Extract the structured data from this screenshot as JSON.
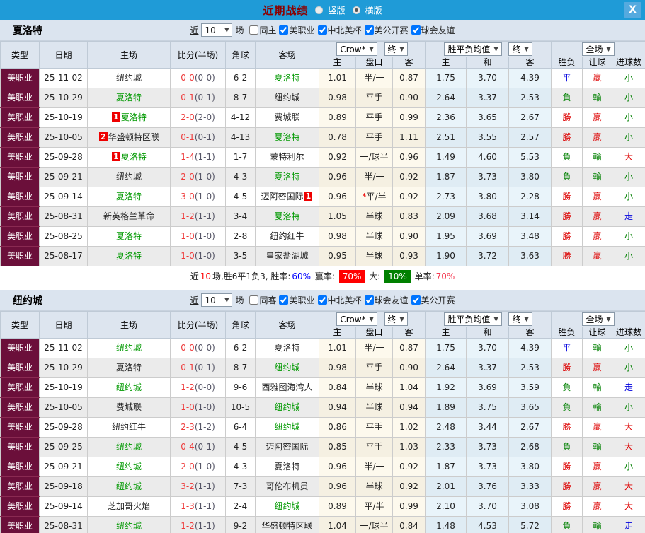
{
  "titlebar": {
    "title": "近期战绩",
    "vertical_label": "竖版",
    "horizontal_label": "横版",
    "horizontal_selected": true
  },
  "icons": {
    "dropdown_arrow": "▼",
    "close": "X"
  },
  "columns": {
    "type": "类型",
    "date": "日期",
    "home": "主场",
    "score": "比分(半场)",
    "corner": "角球",
    "away": "客场",
    "crow": "Crow*",
    "final": "终",
    "avg": "胜平负均值",
    "full": "全场",
    "sub": [
      "主",
      "盘口",
      "客",
      "主",
      "和",
      "客",
      "胜负",
      "让球",
      "进球数"
    ]
  },
  "sections": [
    {
      "team": "夏洛特",
      "near_label": "近",
      "count": "10",
      "games_label": "场",
      "same_label": "同主",
      "same_checked": false,
      "leagues": [
        {
          "label": "美职业",
          "checked": true
        },
        {
          "label": "中北美杯",
          "checked": true
        },
        {
          "label": "美公开赛",
          "checked": true
        },
        {
          "label": "球会友谊",
          "checked": true
        }
      ],
      "rows": [
        {
          "league": "美职业",
          "date": "25-11-02",
          "home": {
            "name": "纽约城",
            "self": false
          },
          "score_ft": "0-0",
          "score_ht": "(0-0)",
          "corner": "6-2",
          "away": {
            "name": "夏洛特",
            "self": true
          },
          "odds_home": "1.01",
          "handicap": "半/一",
          "handicap_star": false,
          "odds_away": "0.87",
          "avg_home": "1.75",
          "avg_draw": "3.70",
          "avg_away": "4.39",
          "res_wdl": {
            "t": "平",
            "c": "blue"
          },
          "res_handicap": {
            "t": "贏",
            "c": "red"
          },
          "res_goals": {
            "t": "小",
            "c": "green"
          }
        },
        {
          "league": "美职业",
          "date": "25-10-29",
          "home": {
            "name": "夏洛特",
            "self": true
          },
          "score_ft": "0-1",
          "score_ht": "(0-1)",
          "corner": "8-7",
          "away": {
            "name": "纽约城",
            "self": false
          },
          "odds_home": "0.98",
          "handicap": "平手",
          "handicap_star": false,
          "odds_away": "0.90",
          "avg_home": "2.64",
          "avg_draw": "3.37",
          "avg_away": "2.53",
          "res_wdl": {
            "t": "負",
            "c": "green"
          },
          "res_handicap": {
            "t": "輸",
            "c": "green"
          },
          "res_goals": {
            "t": "小",
            "c": "green"
          }
        },
        {
          "league": "美职业",
          "date": "25-10-19",
          "home": {
            "name": "夏洛特",
            "self": true,
            "badge": "1",
            "badge_pos": "before"
          },
          "score_ft": "2-0",
          "score_ht": "(2-0)",
          "corner": "4-12",
          "away": {
            "name": "费城联",
            "self": false
          },
          "odds_home": "0.89",
          "handicap": "平手",
          "handicap_star": false,
          "odds_away": "0.99",
          "avg_home": "2.36",
          "avg_draw": "3.65",
          "avg_away": "2.67",
          "res_wdl": {
            "t": "勝",
            "c": "red"
          },
          "res_handicap": {
            "t": "贏",
            "c": "red"
          },
          "res_goals": {
            "t": "小",
            "c": "green"
          }
        },
        {
          "league": "美职业",
          "date": "25-10-05",
          "home": {
            "name": "华盛顿特区联",
            "self": false,
            "badge": "2",
            "badge_pos": "before"
          },
          "score_ft": "0-1",
          "score_ht": "(0-1)",
          "corner": "4-13",
          "away": {
            "name": "夏洛特",
            "self": true
          },
          "odds_home": "0.78",
          "handicap": "平手",
          "handicap_star": false,
          "odds_away": "1.11",
          "avg_home": "2.51",
          "avg_draw": "3.55",
          "avg_away": "2.57",
          "res_wdl": {
            "t": "勝",
            "c": "red"
          },
          "res_handicap": {
            "t": "贏",
            "c": "red"
          },
          "res_goals": {
            "t": "小",
            "c": "green"
          }
        },
        {
          "league": "美职业",
          "date": "25-09-28",
          "home": {
            "name": "夏洛特",
            "self": true,
            "badge": "1",
            "badge_pos": "before"
          },
          "score_ft": "1-4",
          "score_ht": "(1-1)",
          "corner": "1-7",
          "away": {
            "name": "蒙特利尔",
            "self": false
          },
          "odds_home": "0.92",
          "handicap": "一/球半",
          "handicap_star": false,
          "odds_away": "0.96",
          "avg_home": "1.49",
          "avg_draw": "4.60",
          "avg_away": "5.53",
          "res_wdl": {
            "t": "負",
            "c": "green"
          },
          "res_handicap": {
            "t": "輸",
            "c": "green"
          },
          "res_goals": {
            "t": "大",
            "c": "red"
          }
        },
        {
          "league": "美职业",
          "date": "25-09-21",
          "home": {
            "name": "纽约城",
            "self": false
          },
          "score_ft": "2-0",
          "score_ht": "(1-0)",
          "corner": "4-3",
          "away": {
            "name": "夏洛特",
            "self": true
          },
          "odds_home": "0.96",
          "handicap": "半/一",
          "handicap_star": false,
          "odds_away": "0.92",
          "avg_home": "1.87",
          "avg_draw": "3.73",
          "avg_away": "3.80",
          "res_wdl": {
            "t": "負",
            "c": "green"
          },
          "res_handicap": {
            "t": "輸",
            "c": "green"
          },
          "res_goals": {
            "t": "小",
            "c": "green"
          }
        },
        {
          "league": "美职业",
          "date": "25-09-14",
          "home": {
            "name": "夏洛特",
            "self": true
          },
          "score_ft": "3-0",
          "score_ht": "(1-0)",
          "corner": "4-5",
          "away": {
            "name": "迈阿密国际",
            "self": false,
            "badge": "1",
            "badge_pos": "after"
          },
          "odds_home": "0.96",
          "handicap": "平/半",
          "handicap_star": true,
          "odds_away": "0.92",
          "avg_home": "2.73",
          "avg_draw": "3.80",
          "avg_away": "2.28",
          "res_wdl": {
            "t": "勝",
            "c": "red"
          },
          "res_handicap": {
            "t": "贏",
            "c": "red"
          },
          "res_goals": {
            "t": "小",
            "c": "green"
          }
        },
        {
          "league": "美职业",
          "date": "25-08-31",
          "home": {
            "name": "新英格兰革命",
            "self": false
          },
          "score_ft": "1-2",
          "score_ht": "(1-1)",
          "corner": "3-4",
          "away": {
            "name": "夏洛特",
            "self": true
          },
          "odds_home": "1.05",
          "handicap": "半球",
          "handicap_star": false,
          "odds_away": "0.83",
          "avg_home": "2.09",
          "avg_draw": "3.68",
          "avg_away": "3.14",
          "res_wdl": {
            "t": "勝",
            "c": "red"
          },
          "res_handicap": {
            "t": "贏",
            "c": "red"
          },
          "res_goals": {
            "t": "走",
            "c": "blue"
          }
        },
        {
          "league": "美职业",
          "date": "25-08-25",
          "home": {
            "name": "夏洛特",
            "self": true
          },
          "score_ft": "1-0",
          "score_ht": "(1-0)",
          "corner": "2-8",
          "away": {
            "name": "纽约红牛",
            "self": false
          },
          "odds_home": "0.98",
          "handicap": "半球",
          "handicap_star": false,
          "odds_away": "0.90",
          "avg_home": "1.95",
          "avg_draw": "3.69",
          "avg_away": "3.48",
          "res_wdl": {
            "t": "勝",
            "c": "red"
          },
          "res_handicap": {
            "t": "贏",
            "c": "red"
          },
          "res_goals": {
            "t": "小",
            "c": "green"
          }
        },
        {
          "league": "美职业",
          "date": "25-08-17",
          "home": {
            "name": "夏洛特",
            "self": true
          },
          "score_ft": "1-0",
          "score_ht": "(1-0)",
          "corner": "3-5",
          "away": {
            "name": "皇家盐湖城",
            "self": false
          },
          "odds_home": "0.95",
          "handicap": "半球",
          "handicap_star": false,
          "odds_away": "0.93",
          "avg_home": "1.90",
          "avg_draw": "3.72",
          "avg_away": "3.63",
          "res_wdl": {
            "t": "勝",
            "c": "red"
          },
          "res_handicap": {
            "t": "贏",
            "c": "red"
          },
          "res_goals": {
            "t": "小",
            "c": "green"
          }
        }
      ],
      "summary": [
        {
          "t": "近",
          "s": "plain"
        },
        {
          "t": "10",
          "s": "red"
        },
        {
          "t": "场,胜6平1负3, 胜率:",
          "s": "plain"
        },
        {
          "t": "60%",
          "s": "blue"
        },
        {
          "t": " 赢率: ",
          "s": "plain"
        },
        {
          "t": "70%",
          "s": "boxred"
        },
        {
          "t": " 大: ",
          "s": "plain"
        },
        {
          "t": "10%",
          "s": "boxgreen"
        },
        {
          "t": " 单率:",
          "s": "plain"
        },
        {
          "t": "70%",
          "s": "pink"
        }
      ]
    },
    {
      "team": "纽约城",
      "near_label": "近",
      "count": "10",
      "games_label": "场",
      "same_label": "同客",
      "same_checked": false,
      "leagues": [
        {
          "label": "美职业",
          "checked": true
        },
        {
          "label": "中北美杯",
          "checked": true
        },
        {
          "label": "球会友谊",
          "checked": true
        },
        {
          "label": "美公开赛",
          "checked": true
        }
      ],
      "rows": [
        {
          "league": "美职业",
          "date": "25-11-02",
          "home": {
            "name": "纽约城",
            "self": true
          },
          "score_ft": "0-0",
          "score_ht": "(0-0)",
          "corner": "6-2",
          "away": {
            "name": "夏洛特",
            "self": false
          },
          "odds_home": "1.01",
          "handicap": "半/一",
          "handicap_star": false,
          "odds_away": "0.87",
          "avg_home": "1.75",
          "avg_draw": "3.70",
          "avg_away": "4.39",
          "res_wdl": {
            "t": "平",
            "c": "blue"
          },
          "res_handicap": {
            "t": "輸",
            "c": "green"
          },
          "res_goals": {
            "t": "小",
            "c": "green"
          }
        },
        {
          "league": "美职业",
          "date": "25-10-29",
          "home": {
            "name": "夏洛特",
            "self": false
          },
          "score_ft": "0-1",
          "score_ht": "(0-1)",
          "corner": "8-7",
          "away": {
            "name": "纽约城",
            "self": true
          },
          "odds_home": "0.98",
          "handicap": "平手",
          "handicap_star": false,
          "odds_away": "0.90",
          "avg_home": "2.64",
          "avg_draw": "3.37",
          "avg_away": "2.53",
          "res_wdl": {
            "t": "勝",
            "c": "red"
          },
          "res_handicap": {
            "t": "贏",
            "c": "red"
          },
          "res_goals": {
            "t": "小",
            "c": "green"
          }
        },
        {
          "league": "美职业",
          "date": "25-10-19",
          "home": {
            "name": "纽约城",
            "self": true
          },
          "score_ft": "1-2",
          "score_ht": "(0-0)",
          "corner": "9-6",
          "away": {
            "name": "西雅图海湾人",
            "self": false
          },
          "odds_home": "0.84",
          "handicap": "半球",
          "handicap_star": false,
          "odds_away": "1.04",
          "avg_home": "1.92",
          "avg_draw": "3.69",
          "avg_away": "3.59",
          "res_wdl": {
            "t": "負",
            "c": "green"
          },
          "res_handicap": {
            "t": "輸",
            "c": "green"
          },
          "res_goals": {
            "t": "走",
            "c": "blue"
          }
        },
        {
          "league": "美职业",
          "date": "25-10-05",
          "home": {
            "name": "费城联",
            "self": false
          },
          "score_ft": "1-0",
          "score_ht": "(1-0)",
          "corner": "10-5",
          "away": {
            "name": "纽约城",
            "self": true
          },
          "odds_home": "0.94",
          "handicap": "半球",
          "handicap_star": false,
          "odds_away": "0.94",
          "avg_home": "1.89",
          "avg_draw": "3.75",
          "avg_away": "3.65",
          "res_wdl": {
            "t": "負",
            "c": "green"
          },
          "res_handicap": {
            "t": "輸",
            "c": "green"
          },
          "res_goals": {
            "t": "小",
            "c": "green"
          }
        },
        {
          "league": "美职业",
          "date": "25-09-28",
          "home": {
            "name": "纽约红牛",
            "self": false
          },
          "score_ft": "2-3",
          "score_ht": "(1-2)",
          "corner": "6-4",
          "away": {
            "name": "纽约城",
            "self": true
          },
          "odds_home": "0.86",
          "handicap": "平手",
          "handicap_star": false,
          "odds_away": "1.02",
          "avg_home": "2.48",
          "avg_draw": "3.44",
          "avg_away": "2.67",
          "res_wdl": {
            "t": "勝",
            "c": "red"
          },
          "res_handicap": {
            "t": "贏",
            "c": "red"
          },
          "res_goals": {
            "t": "大",
            "c": "red"
          }
        },
        {
          "league": "美职业",
          "date": "25-09-25",
          "home": {
            "name": "纽约城",
            "self": true
          },
          "score_ft": "0-4",
          "score_ht": "(0-1)",
          "corner": "4-5",
          "away": {
            "name": "迈阿密国际",
            "self": false
          },
          "odds_home": "0.85",
          "handicap": "平手",
          "handicap_star": false,
          "odds_away": "1.03",
          "avg_home": "2.33",
          "avg_draw": "3.73",
          "avg_away": "2.68",
          "res_wdl": {
            "t": "負",
            "c": "green"
          },
          "res_handicap": {
            "t": "輸",
            "c": "green"
          },
          "res_goals": {
            "t": "大",
            "c": "red"
          }
        },
        {
          "league": "美职业",
          "date": "25-09-21",
          "home": {
            "name": "纽约城",
            "self": true
          },
          "score_ft": "2-0",
          "score_ht": "(1-0)",
          "corner": "4-3",
          "away": {
            "name": "夏洛特",
            "self": false
          },
          "odds_home": "0.96",
          "handicap": "半/一",
          "handicap_star": false,
          "odds_away": "0.92",
          "avg_home": "1.87",
          "avg_draw": "3.73",
          "avg_away": "3.80",
          "res_wdl": {
            "t": "勝",
            "c": "red"
          },
          "res_handicap": {
            "t": "贏",
            "c": "red"
          },
          "res_goals": {
            "t": "小",
            "c": "green"
          }
        },
        {
          "league": "美职业",
          "date": "25-09-18",
          "home": {
            "name": "纽约城",
            "self": true
          },
          "score_ft": "3-2",
          "score_ht": "(1-1)",
          "corner": "7-3",
          "away": {
            "name": "哥伦布机员",
            "self": false
          },
          "odds_home": "0.96",
          "handicap": "半球",
          "handicap_star": false,
          "odds_away": "0.92",
          "avg_home": "2.01",
          "avg_draw": "3.76",
          "avg_away": "3.33",
          "res_wdl": {
            "t": "勝",
            "c": "red"
          },
          "res_handicap": {
            "t": "贏",
            "c": "red"
          },
          "res_goals": {
            "t": "大",
            "c": "red"
          }
        },
        {
          "league": "美职业",
          "date": "25-09-14",
          "home": {
            "name": "芝加哥火焰",
            "self": false
          },
          "score_ft": "1-3",
          "score_ht": "(1-1)",
          "corner": "2-4",
          "away": {
            "name": "纽约城",
            "self": true
          },
          "odds_home": "0.89",
          "handicap": "平/半",
          "handicap_star": false,
          "odds_away": "0.99",
          "avg_home": "2.10",
          "avg_draw": "3.70",
          "avg_away": "3.08",
          "res_wdl": {
            "t": "勝",
            "c": "red"
          },
          "res_handicap": {
            "t": "贏",
            "c": "red"
          },
          "res_goals": {
            "t": "大",
            "c": "red"
          }
        },
        {
          "league": "美职业",
          "date": "25-08-31",
          "home": {
            "name": "纽约城",
            "self": true
          },
          "score_ft": "1-2",
          "score_ht": "(1-1)",
          "corner": "9-2",
          "away": {
            "name": "华盛顿特区联",
            "self": false
          },
          "odds_home": "1.04",
          "handicap": "一/球半",
          "handicap_star": false,
          "odds_away": "0.84",
          "avg_home": "1.48",
          "avg_draw": "4.53",
          "avg_away": "5.72",
          "res_wdl": {
            "t": "負",
            "c": "green"
          },
          "res_handicap": {
            "t": "輸",
            "c": "green"
          },
          "res_goals": {
            "t": "走",
            "c": "blue"
          }
        }
      ],
      "summary": null
    }
  ]
}
